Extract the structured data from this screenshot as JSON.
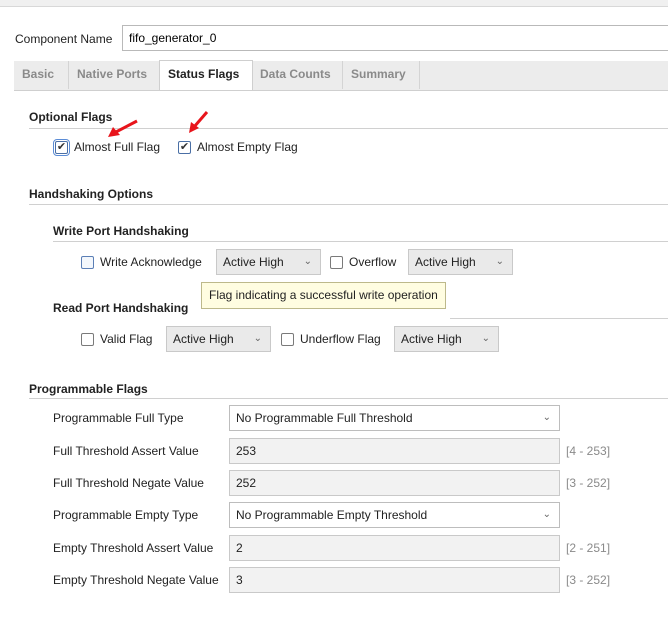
{
  "component": {
    "label": "Component Name",
    "value": "fifo_generator_0"
  },
  "tabs": [
    {
      "label": "Basic",
      "active": false
    },
    {
      "label": "Native Ports",
      "active": false
    },
    {
      "label": "Status Flags",
      "active": true
    },
    {
      "label": "Data Counts",
      "active": false
    },
    {
      "label": "Summary",
      "active": false
    }
  ],
  "optional_flags": {
    "title": "Optional Flags",
    "almost_full": {
      "label": "Almost Full Flag",
      "checked": true
    },
    "almost_empty": {
      "label": "Almost Empty Flag",
      "checked": true
    }
  },
  "handshaking": {
    "title": "Handshaking Options",
    "write": {
      "title": "Write Port Handshaking",
      "write_ack": {
        "label": "Write Acknowledge",
        "checked": false,
        "polarity": "Active High"
      },
      "overflow": {
        "label": "Overflow",
        "checked": false,
        "polarity": "Active High"
      }
    },
    "read": {
      "title": "Read Port Handshaking",
      "valid": {
        "label": "Valid Flag",
        "checked": false,
        "polarity": "Active High"
      },
      "underflow": {
        "label": "Underflow Flag",
        "checked": false,
        "polarity": "Active High"
      }
    },
    "tooltip": "Flag indicating a successful write operation"
  },
  "programmable": {
    "title": "Programmable Flags",
    "full_type": {
      "label": "Programmable Full Type",
      "value": "No Programmable Full Threshold"
    },
    "full_assert": {
      "label": "Full Threshold Assert Value",
      "value": "253",
      "range": "[4 - 253]"
    },
    "full_negate": {
      "label": "Full Threshold Negate Value",
      "value": "252",
      "range": "[3 - 252]"
    },
    "empty_type": {
      "label": "Programmable Empty Type",
      "value": "No Programmable Empty Threshold"
    },
    "empty_assert": {
      "label": "Empty Threshold Assert Value",
      "value": "2",
      "range": "[2 - 251]"
    },
    "empty_negate": {
      "label": "Empty Threshold Negate Value",
      "value": "3",
      "range": "[3 - 252]"
    }
  },
  "icons": {
    "check": "✔",
    "chevron": "⌄",
    "annotation_arrow_color": "#e8141b"
  }
}
